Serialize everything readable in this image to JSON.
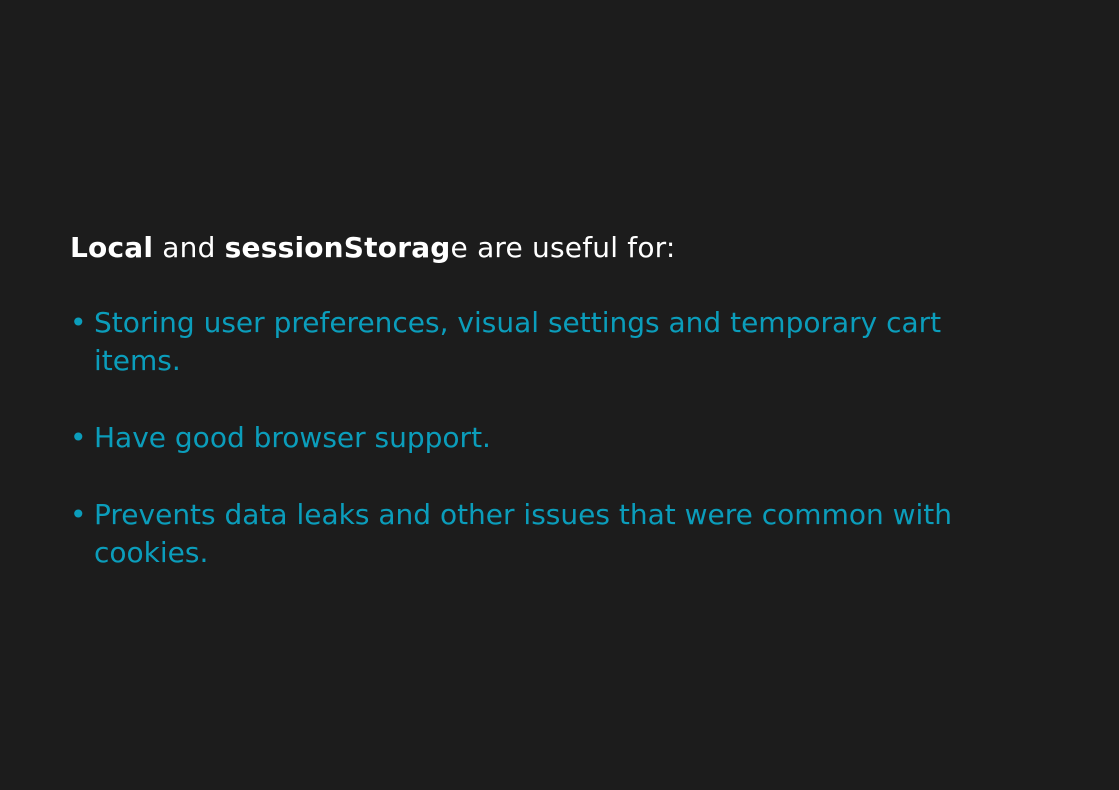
{
  "intro": {
    "part1": "Local",
    "part2": " and ",
    "part3": "sessionStorag",
    "part4": "e are useful for:"
  },
  "bullet_marker": "•",
  "bullets": [
    "Storing user preferences, visual settings and temporary cart items.",
    "Have good browser support.",
    "Prevents data leaks and other issues that were common with cookies."
  ],
  "colors": {
    "background": "#1c1c1c",
    "heading": "#ffffff",
    "accent": "#0b9dbb"
  }
}
